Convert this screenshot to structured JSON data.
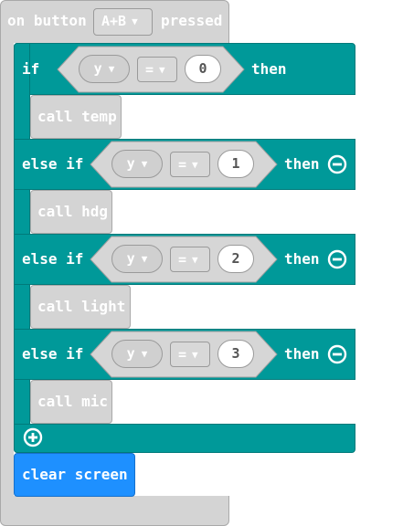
{
  "event": {
    "prefix": "on button",
    "button": "A+B",
    "suffix": "pressed"
  },
  "if_block": {
    "if_label": "if",
    "else_if_label": "else if",
    "then_label": "then",
    "conditions": [
      {
        "var": "y",
        "op": "=",
        "value": "0",
        "call": "call temp"
      },
      {
        "var": "y",
        "op": "=",
        "value": "1",
        "call": "call hdg"
      },
      {
        "var": "y",
        "op": "=",
        "value": "2",
        "call": "call light"
      },
      {
        "var": "y",
        "op": "=",
        "value": "3",
        "call": "call mic"
      }
    ]
  },
  "after": {
    "clear_screen": "clear screen"
  },
  "icons": {
    "dropdown": "chevron-down-icon",
    "remove": "minus-circle-icon",
    "add": "plus-circle-icon"
  },
  "colors": {
    "event": "#d4d4d4",
    "logic": "#009999",
    "basic": "#1e90ff"
  }
}
